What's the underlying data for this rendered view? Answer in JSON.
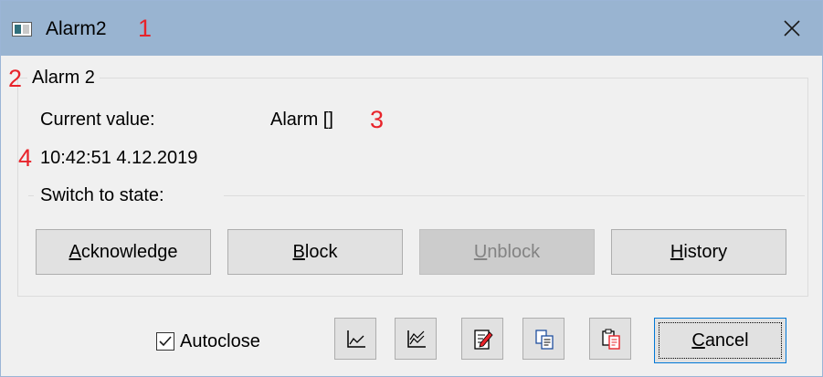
{
  "window": {
    "title": "Alarm2",
    "annotations": [
      "1",
      "2",
      "3",
      "4"
    ]
  },
  "group": {
    "label": "Alarm 2",
    "current_value_label": "Current value:",
    "current_value": "Alarm []",
    "timestamp": "10:42:51 4.12.2019",
    "switch_label": "Switch to state:"
  },
  "state_buttons": {
    "acknowledge": {
      "underline": "A",
      "rest": "cknowledge"
    },
    "block": {
      "underline": "B",
      "rest": "lock"
    },
    "unblock": {
      "underline": "U",
      "rest": "nblock",
      "enabled": false
    },
    "history": {
      "underline": "H",
      "rest": "istory"
    }
  },
  "footer": {
    "autoclose_label": "Autoclose",
    "autoclose_checked": true,
    "icons": [
      "trend-icon",
      "multi-trend-icon",
      "edit-icon",
      "copy-icon",
      "paste-icon"
    ],
    "cancel": {
      "underline": "C",
      "rest": "ancel"
    }
  },
  "colors": {
    "titlebar": "#99b4d1",
    "annotation": "#e8232a",
    "edit_pencil": "#e8232a"
  }
}
